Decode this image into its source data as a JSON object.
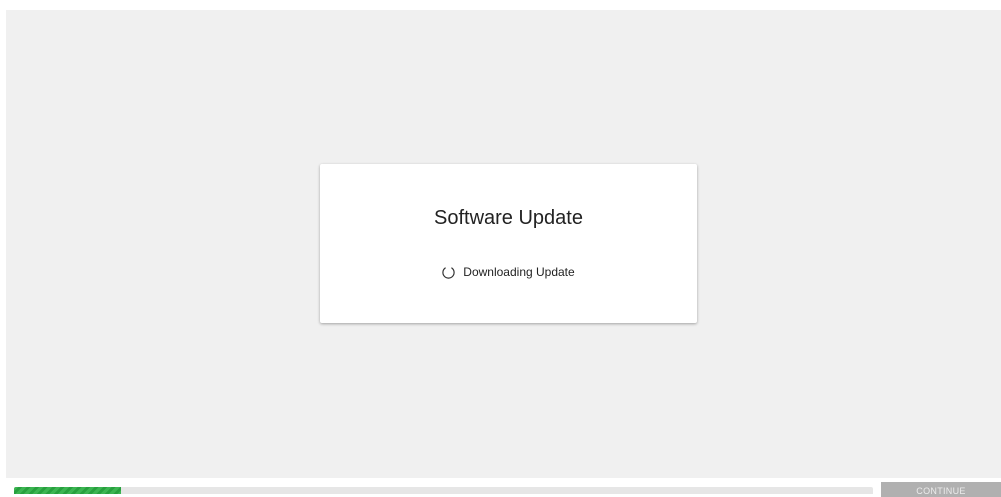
{
  "dialog": {
    "title": "Software Update",
    "status_text": "Downloading Update",
    "status_icon": "spinner-icon"
  },
  "footer": {
    "progress_fraction": 0.125,
    "progress_color": "#3cb552",
    "continue_label": "CONTINUE",
    "continue_enabled": false
  },
  "colors": {
    "background": "#f0f0f0",
    "dialog": "#ffffff",
    "button_disabled": "#b0b0b0"
  }
}
